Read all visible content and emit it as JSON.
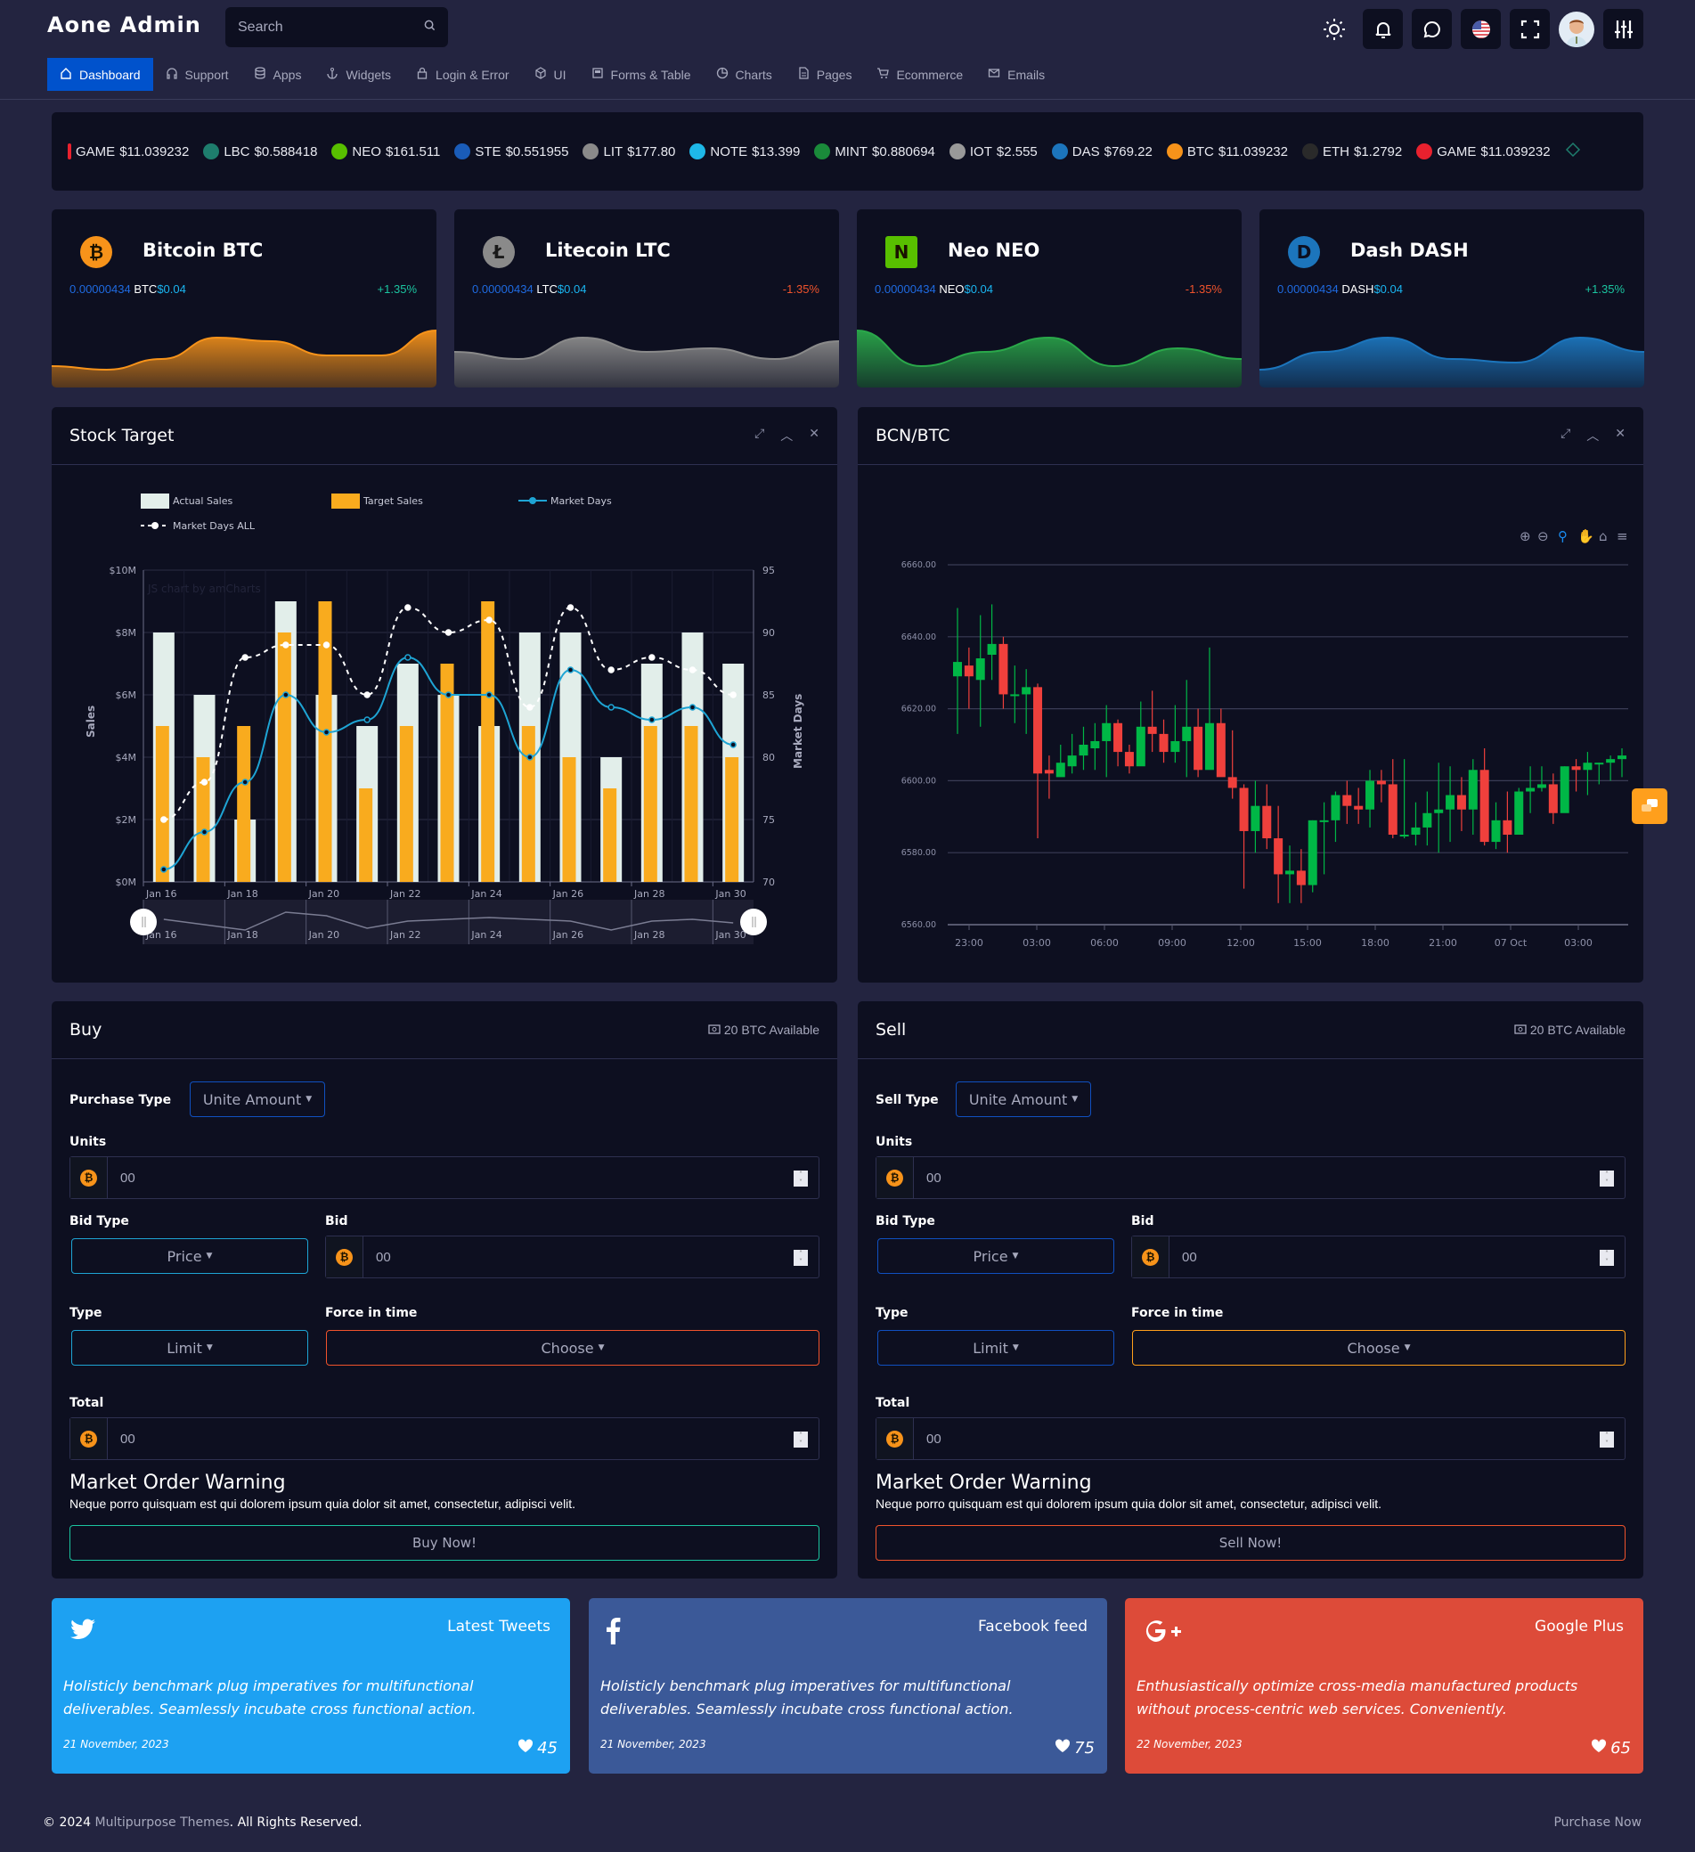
{
  "header": {
    "logo": "Aone Admin",
    "search_placeholder": "Search",
    "icons": [
      "sun-icon",
      "bell-icon",
      "chat-icon",
      "us-flag-icon",
      "fullscreen-icon",
      "avatar",
      "settings-sliders-icon"
    ]
  },
  "nav": [
    {
      "label": "Dashboard",
      "icon": "home-icon",
      "active": true
    },
    {
      "label": "Support",
      "icon": "headphones-icon"
    },
    {
      "label": "Apps",
      "icon": "database-icon"
    },
    {
      "label": "Widgets",
      "icon": "anchor-icon"
    },
    {
      "label": "Login & Error",
      "icon": "lock-icon"
    },
    {
      "label": "UI",
      "icon": "cube-icon"
    },
    {
      "label": "Forms & Table",
      "icon": "form-icon"
    },
    {
      "label": "Charts",
      "icon": "pie-icon"
    },
    {
      "label": "Pages",
      "icon": "page-icon"
    },
    {
      "label": "Ecommerce",
      "icon": "cart-icon"
    },
    {
      "label": "Emails",
      "icon": "mail-icon"
    }
  ],
  "ticker": [
    {
      "symbol": "GAME",
      "price": "$11.039232",
      "color": "#e8212e"
    },
    {
      "symbol": "LBC",
      "price": "$0.588418",
      "color": "#1e7d6d"
    },
    {
      "symbol": "NEO",
      "price": "$161.511",
      "color": "#58bf00"
    },
    {
      "symbol": "STE",
      "price": "$0.551955",
      "color": "#1a5cb8"
    },
    {
      "symbol": "LIT",
      "price": "$177.80",
      "color": "#8a8a8a"
    },
    {
      "symbol": "NOTE",
      "price": "$13.399",
      "color": "#1eb8e8"
    },
    {
      "symbol": "MINT",
      "price": "$0.880694",
      "color": "#1a8a3a"
    },
    {
      "symbol": "IOT",
      "price": "$2.555",
      "color": "#999999"
    },
    {
      "symbol": "DAS",
      "price": "$769.22",
      "color": "#1c75bc"
    },
    {
      "symbol": "BTC",
      "price": "$11.039232",
      "color": "#f7931a"
    },
    {
      "symbol": "ETH",
      "price": "$1.2792",
      "color": "#2a2a2a"
    },
    {
      "symbol": "GAME",
      "price": "$11.039232",
      "color": "#e8212e"
    }
  ],
  "coins": [
    {
      "name": "Bitcoin BTC",
      "amount": "0.00000434",
      "sym": "BTC",
      "usd": "$0.04",
      "change": "+1.35%",
      "positive": true,
      "color": "#f7931a",
      "icon": "bitcoin-icon",
      "spark": [
        3,
        2.5,
        4,
        7,
        6.5,
        4.5,
        4.5,
        8
      ],
      "glyph": "₿"
    },
    {
      "name": "Litecoin LTC",
      "amount": "0.00000434",
      "sym": "LTC",
      "usd": "$0.04",
      "change": "-1.35%",
      "positive": false,
      "color": "#8a8a8a",
      "icon": "litecoin-icon",
      "spark": [
        5,
        4,
        7,
        5,
        5.5,
        4,
        6.5
      ],
      "glyph": "Ł"
    },
    {
      "name": "Neo NEO",
      "amount": "0.00000434",
      "sym": "NEO",
      "usd": "$0.04",
      "change": "-1.35%",
      "positive": false,
      "color": "#2aa84a",
      "icon": "neo-icon",
      "spark": [
        8,
        3,
        5,
        7,
        3,
        5.5,
        4
      ],
      "glyph": "N"
    },
    {
      "name": "Dash DASH",
      "amount": "0.00000434",
      "sym": "DASH",
      "usd": "$0.04",
      "change": "+1.35%",
      "positive": true,
      "color": "#1c75bc",
      "icon": "dash-icon",
      "spark": [
        2.5,
        5,
        7,
        4,
        3.5,
        7,
        5
      ],
      "glyph": "D"
    }
  ],
  "stock_panel": {
    "title": "Stock Target",
    "watermark": "JS chart by amCharts"
  },
  "bcn_panel": {
    "title": "BCN/BTC"
  },
  "chart_data": [
    {
      "type": "bar",
      "title": "Stock Target",
      "categories": [
        "Jan 16",
        "Jan 17",
        "Jan 18",
        "Jan 19",
        "Jan 20",
        "Jan 21",
        "Jan 22",
        "Jan 23",
        "Jan 24",
        "Jan 25",
        "Jan 26",
        "Jan 27",
        "Jan 28",
        "Jan 29",
        "Jan 30"
      ],
      "x_tick_labels": [
        "Jan 16",
        "Jan 18",
        "Jan 20",
        "Jan 22",
        "Jan 24",
        "Jan 26",
        "Jan 28",
        "Jan 30"
      ],
      "series": [
        {
          "name": "Actual Sales",
          "type": "bar",
          "axis": "left",
          "color": "#e2eeea",
          "values": [
            8,
            6,
            2,
            9,
            6,
            5,
            7,
            6,
            5,
            8,
            8,
            4,
            7,
            8,
            7
          ]
        },
        {
          "name": "Target Sales",
          "type": "bar",
          "axis": "left",
          "color": "#f9ab1e",
          "values": [
            5,
            4,
            5,
            8,
            9,
            3,
            5,
            7,
            9,
            5,
            4,
            3,
            5,
            5,
            4
          ]
        },
        {
          "name": "Market Days",
          "type": "line",
          "axis": "right",
          "color": "#1ea4d4",
          "values": [
            71,
            74,
            78,
            85,
            82,
            83,
            88,
            85,
            85,
            80,
            87,
            84,
            83,
            84,
            81
          ]
        },
        {
          "name": "Market Days ALL",
          "type": "line",
          "axis": "right",
          "dashed": true,
          "color": "#ffffff",
          "values": [
            75,
            78,
            88,
            89,
            89,
            85,
            92,
            90,
            91,
            84,
            92,
            87,
            88,
            87,
            85
          ]
        }
      ],
      "ylabel": "Sales",
      "y2label": "Market Days",
      "ylim": [
        0,
        10
      ],
      "y_ticks": [
        "$0M",
        "$2M",
        "$4M",
        "$6M",
        "$8M",
        "$10M"
      ],
      "y2lim": [
        70,
        95
      ],
      "y2_ticks": [
        "70",
        "75",
        "80",
        "85",
        "90",
        "95"
      ],
      "legend": "top"
    },
    {
      "type": "candlestick",
      "title": "BCN/BTC",
      "ylim": [
        6560,
        6660
      ],
      "y_ticks": [
        "6560.00",
        "6580.00",
        "6600.00",
        "6620.00",
        "6640.00",
        "6660.00"
      ],
      "x_ticks": [
        "23:00",
        "03:00",
        "06:00",
        "09:00",
        "12:00",
        "15:00",
        "18:00",
        "21:00",
        "07 Oct",
        "03:00"
      ],
      "up_color": "#00b746",
      "down_color": "#ef403c",
      "candles": [
        [
          6629,
          6633,
          6648,
          6613
        ],
        [
          6632,
          6629,
          6637,
          6620
        ],
        [
          6628,
          6634,
          6646,
          6615
        ],
        [
          6635,
          6638,
          6649,
          6628
        ],
        [
          6638,
          6624,
          6640,
          6620
        ],
        [
          6624,
          6624,
          6632,
          6616
        ],
        [
          6624,
          6626,
          6631,
          6613
        ],
        [
          6626,
          6602,
          6627,
          6584
        ],
        [
          6603,
          6602,
          6607,
          6595
        ],
        [
          6601,
          6605,
          6610,
          6602
        ],
        [
          6604,
          6607,
          6613,
          6602
        ],
        [
          6607,
          6610,
          6615,
          6603
        ],
        [
          6609,
          6611,
          6616,
          6603
        ],
        [
          6611,
          6616,
          6621,
          6601
        ],
        [
          6616,
          6608,
          6617,
          6604
        ],
        [
          6608,
          6604,
          6610,
          6602
        ],
        [
          6604,
          6615,
          6622,
          6605
        ],
        [
          6615,
          6613,
          6625,
          6608
        ],
        [
          6613,
          6608,
          6617,
          6605
        ],
        [
          6608,
          6611,
          6621,
          6605
        ],
        [
          6611,
          6615,
          6628,
          6601
        ],
        [
          6615,
          6603,
          6620,
          6601
        ],
        [
          6603,
          6616,
          6637,
          6605
        ],
        [
          6616,
          6601,
          6620,
          6602
        ],
        [
          6601,
          6598,
          6614,
          6595
        ],
        [
          6598,
          6586,
          6599,
          6570
        ],
        [
          6586,
          6593,
          6600,
          6580
        ],
        [
          6593,
          6584,
          6599,
          6581
        ],
        [
          6584,
          6574,
          6593,
          6566
        ],
        [
          6574,
          6575,
          6582,
          6566
        ],
        [
          6575,
          6571,
          6581,
          6566
        ],
        [
          6571,
          6589,
          6589,
          6569
        ],
        [
          6589,
          6589,
          6594,
          6574
        ],
        [
          6589,
          6596,
          6597,
          6583
        ],
        [
          6596,
          6593,
          6600,
          6588
        ],
        [
          6593,
          6592,
          6598,
          6588
        ],
        [
          6592,
          6600,
          6603,
          6587
        ],
        [
          6600,
          6599,
          6603,
          6594
        ],
        [
          6599,
          6585,
          6606,
          6584
        ],
        [
          6585,
          6585,
          6606,
          6584
        ],
        [
          6585,
          6587,
          6594,
          6582
        ],
        [
          6587,
          6591,
          6597,
          6582
        ],
        [
          6591,
          6592,
          6605,
          6580
        ],
        [
          6592,
          6596,
          6604,
          6583
        ],
        [
          6596,
          6592,
          6601,
          6586
        ],
        [
          6592,
          6603,
          6606,
          6585
        ],
        [
          6603,
          6583,
          6609,
          6582
        ],
        [
          6583,
          6589,
          6594,
          6581
        ],
        [
          6589,
          6585,
          6597,
          6580
        ],
        [
          6585,
          6597,
          6598,
          6586
        ],
        [
          6597,
          6598,
          6604,
          6591
        ],
        [
          6598,
          6599,
          6604,
          6597
        ],
        [
          6599,
          6591,
          6602,
          6588
        ],
        [
          6591,
          6604,
          6604,
          6592
        ],
        [
          6604,
          6603,
          6606,
          6597
        ],
        [
          6603,
          6605,
          6608,
          6596
        ],
        [
          6605,
          6605,
          6605,
          6599
        ],
        [
          6605,
          6606,
          6607,
          6600
        ],
        [
          6606,
          6607,
          6609,
          6601
        ]
      ]
    }
  ],
  "chart_toolbar": [
    "zoom-in-icon",
    "zoom-out-icon",
    "zoom-select-icon",
    "pan-hand-icon",
    "home-icon",
    "menu-icon"
  ],
  "buy": {
    "title": "Buy",
    "available": "20 BTC Available",
    "type_label": "Purchase Type",
    "type_value": "Unite Amount",
    "units_label": "Units",
    "units_value": "00",
    "bid_type_label": "Bid Type",
    "bid_type_value": "Price",
    "bid_label": "Bid",
    "bid_value": "00",
    "type2_label": "Type",
    "type2_value": "Limit",
    "force_label": "Force in time",
    "force_value": "Choose",
    "total_label": "Total",
    "total_value": "00",
    "warning_title": "Market Order Warning",
    "warning_text": "Neque porro quisquam est qui dolorem ipsum quia dolor sit amet, consectetur, adipisci velit.",
    "action": "Buy Now!"
  },
  "sell": {
    "title": "Sell",
    "available": "20 BTC Available",
    "type_label": "Sell Type",
    "type_value": "Unite Amount",
    "units_label": "Units",
    "units_value": "00",
    "bid_type_label": "Bid Type",
    "bid_type_value": "Price",
    "bid_label": "Bid",
    "bid_value": "00",
    "type2_label": "Type",
    "type2_value": "Limit",
    "force_label": "Force in time",
    "force_value": "Choose",
    "total_label": "Total",
    "total_value": "00",
    "warning_title": "Market Order Warning",
    "warning_text": "Neque porro quisquam est qui dolorem ipsum quia dolor sit amet, consectetur, adipisci velit.",
    "action": "Sell Now!"
  },
  "social": [
    {
      "title": "Latest Tweets",
      "text": "Holisticly benchmark plug imperatives for multifunctional deliverables. Seamlessly incubate cross functional action.",
      "date": "21 November, 2023",
      "likes": "45",
      "color": "#1da1f2",
      "icon": "twitter-icon"
    },
    {
      "title": "Facebook feed",
      "text": "Holisticly benchmark plug imperatives for multifunctional deliverables. Seamlessly incubate cross functional action.",
      "date": "21 November, 2023",
      "likes": "75",
      "color": "#3b5998",
      "icon": "facebook-icon"
    },
    {
      "title": "Google Plus",
      "text": "Enthusiastically optimize cross-media manufactured products without process-centric web services. Conveniently.",
      "date": "22 November, 2023",
      "likes": "65",
      "color": "#dd4b39",
      "icon": "google-plus-icon"
    }
  ],
  "footer": {
    "prefix": "© 2024 ",
    "brand": "Multipurpose Themes",
    "suffix": ". All Rights Reserved.",
    "right": "Purchase Now"
  }
}
